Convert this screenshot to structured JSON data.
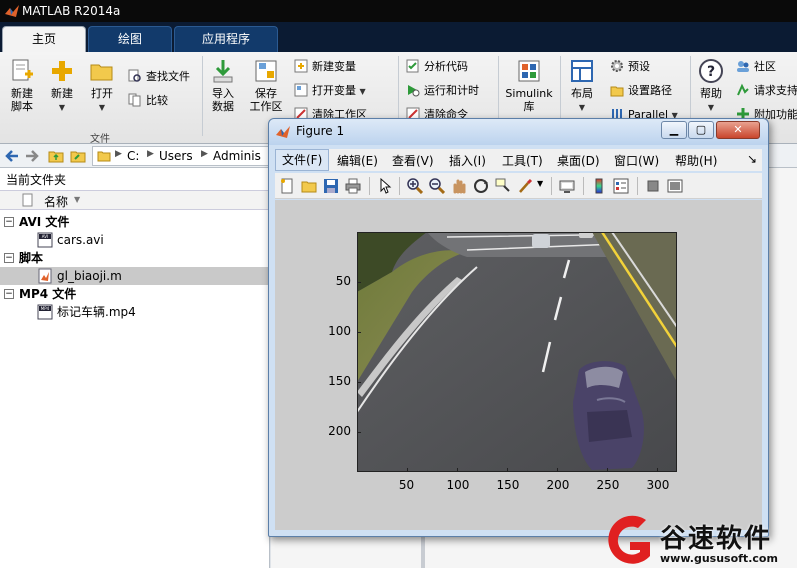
{
  "app": {
    "title": "MATLAB R2014a",
    "tabs": [
      {
        "label": "主页",
        "active": true
      },
      {
        "label": "绘图",
        "active": false
      },
      {
        "label": "应用程序",
        "active": false
      }
    ]
  },
  "ribbon": {
    "new_script": "新建\n脚本",
    "new": "新建",
    "open": "打开",
    "find_files": "查找文件",
    "compare": "比较",
    "file_group": "文件",
    "import_data": "导入\n数据",
    "save_workspace": "保存\n工作区",
    "new_variable": "新建变量",
    "open_variable": "打开变量",
    "clear_workspace": "清除工作区",
    "analyze_code": "分析代码",
    "run_and_time": "运行和计时",
    "clear_commands": "清除命令",
    "simulink": "Simulink\n库",
    "layout": "布局",
    "preferences": "预设",
    "set_path": "设置路径",
    "parallel": "Parallel",
    "help": "帮助",
    "community": "社区",
    "request_support": "请求支持",
    "add_ons": "附加功能"
  },
  "address": {
    "path": [
      "C:",
      "Users",
      "Adminis"
    ]
  },
  "left_panel": {
    "title": "当前文件夹",
    "col_name": "名称",
    "groups": [
      {
        "label": "AVI 文件",
        "files": [
          {
            "name": "cars.avi",
            "icon": "video-file-icon",
            "selected": false
          }
        ]
      },
      {
        "label": "脚本",
        "files": [
          {
            "name": "gl_biaoji.m",
            "icon": "matlab-script-icon",
            "selected": true
          }
        ]
      },
      {
        "label": "MP4 文件",
        "files": [
          {
            "name": "标记车辆.mp4",
            "icon": "video-file-icon",
            "selected": false
          }
        ]
      }
    ]
  },
  "figure": {
    "title": "Figure 1",
    "menus": [
      "文件(F)",
      "编辑(E)",
      "查看(V)",
      "插入(I)",
      "工具(T)",
      "桌面(D)",
      "窗口(W)",
      "帮助(H)"
    ],
    "menu_overflow": "↘",
    "toolbar_icons": [
      "new-figure-icon",
      "open-icon",
      "save-icon",
      "print-icon",
      "pointer-icon",
      "zoom-in-icon",
      "zoom-out-icon",
      "pan-icon",
      "rotate-icon",
      "data-cursor-icon",
      "brush-icon",
      "link-icon",
      "colorbar-icon",
      "legend-icon",
      "hide-plot-tools-icon",
      "show-plot-tools-icon"
    ]
  },
  "chart_data": {
    "type": "image",
    "image_description_visible": false,
    "xlim": [
      0.5,
      320.5
    ],
    "ylim": [
      0.5,
      240.5
    ],
    "y_reversed": true,
    "xticks": [
      50,
      100,
      150,
      200,
      250,
      300
    ],
    "yticks": [
      50,
      100,
      150,
      200
    ]
  },
  "watermark": {
    "text": "谷速软件",
    "url": "www.gususoft.com"
  }
}
